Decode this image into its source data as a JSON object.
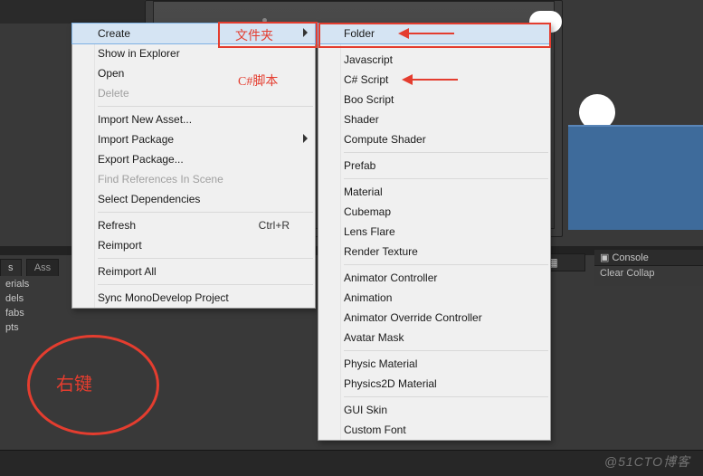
{
  "sidebar": {
    "tab_active": "s",
    "tab_inactive": "Ass",
    "items": [
      "erials",
      "dels",
      "fabs",
      "pts"
    ]
  },
  "menu1": {
    "items": [
      {
        "label": "Create",
        "highlight": true,
        "sub": true
      },
      {
        "label": "Show in Explorer"
      },
      {
        "label": "Open"
      },
      {
        "label": "Delete",
        "disabled": true
      },
      {
        "sep": true
      },
      {
        "label": "Import New Asset..."
      },
      {
        "label": "Import Package",
        "sub": true
      },
      {
        "label": "Export Package..."
      },
      {
        "label": "Find References In Scene",
        "disabled": true
      },
      {
        "label": "Select Dependencies"
      },
      {
        "sep": true
      },
      {
        "label": "Refresh",
        "shortcut": "Ctrl+R"
      },
      {
        "label": "Reimport"
      },
      {
        "sep": true
      },
      {
        "label": "Reimport All"
      },
      {
        "sep": true
      },
      {
        "label": "Sync MonoDevelop Project"
      }
    ]
  },
  "menu2": {
    "items": [
      {
        "label": "Folder",
        "highlight": true
      },
      {
        "sep": true
      },
      {
        "label": "Javascript"
      },
      {
        "label": "C# Script"
      },
      {
        "label": "Boo Script"
      },
      {
        "label": "Shader"
      },
      {
        "label": "Compute Shader"
      },
      {
        "sep": true
      },
      {
        "label": "Prefab"
      },
      {
        "sep": true
      },
      {
        "label": "Material"
      },
      {
        "label": "Cubemap"
      },
      {
        "label": "Lens Flare"
      },
      {
        "label": "Render Texture"
      },
      {
        "sep": true
      },
      {
        "label": "Animator Controller"
      },
      {
        "label": "Animation"
      },
      {
        "label": "Animator Override Controller"
      },
      {
        "label": "Avatar Mask"
      },
      {
        "sep": true
      },
      {
        "label": "Physic Material"
      },
      {
        "label": "Physics2D Material"
      },
      {
        "sep": true
      },
      {
        "label": "GUI Skin"
      },
      {
        "label": "Custom Font"
      }
    ]
  },
  "console": {
    "title": "Console",
    "sub": "Clear    Collap"
  },
  "annotations": {
    "folder_label": "文件夹",
    "script_label": "C#脚本",
    "rightclick_label": "右键"
  },
  "watermark": "@51CTO博客"
}
